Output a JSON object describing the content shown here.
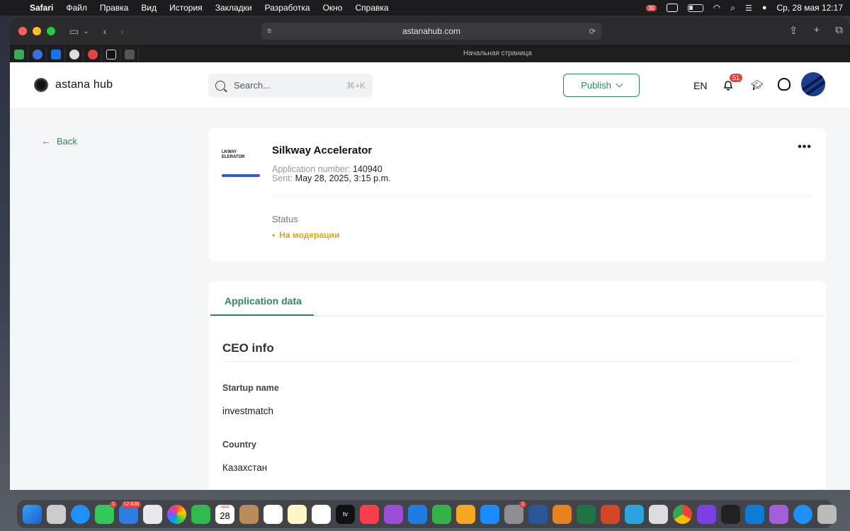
{
  "menubar": {
    "app": "Safari",
    "items": [
      "Файл",
      "Правка",
      "Вид",
      "История",
      "Закладки",
      "Разработка",
      "Окно",
      "Справка"
    ],
    "badge": "30",
    "clock": "Ср, 28 мая  12:17"
  },
  "browser": {
    "url": "astanahub.com",
    "tab_title": "Начальная страница"
  },
  "header": {
    "logo": "astana hub",
    "search_placeholder": "Search...",
    "search_shortcut": "⌘+K",
    "publish_label": "Publish",
    "lang": "EN",
    "notifications_count": "51"
  },
  "back_label": "Back",
  "application": {
    "thumb_text": "LKWAY\nELERATOR",
    "title": "Silkway Accelerator",
    "number_label": "Application number:",
    "number": "140940",
    "sent_label": "Sent:",
    "sent": "May 28, 2025, 3:15 p.m.",
    "status_label": "Status",
    "status": "На модерации",
    "status_color": "#e5a21e"
  },
  "details": {
    "tab": "Application data",
    "section": "CEO info",
    "fields": [
      {
        "label": "Startup name",
        "value": "investmatch"
      },
      {
        "label": "Country",
        "value": "Казахстан"
      }
    ]
  },
  "colors": {
    "accent": "#2f8a5a"
  },
  "dock": {
    "badges": {
      "messages": "1",
      "mail": "12 828",
      "settings": "1"
    },
    "calendar_day": "28",
    "calendar_month": "МАЯ"
  }
}
